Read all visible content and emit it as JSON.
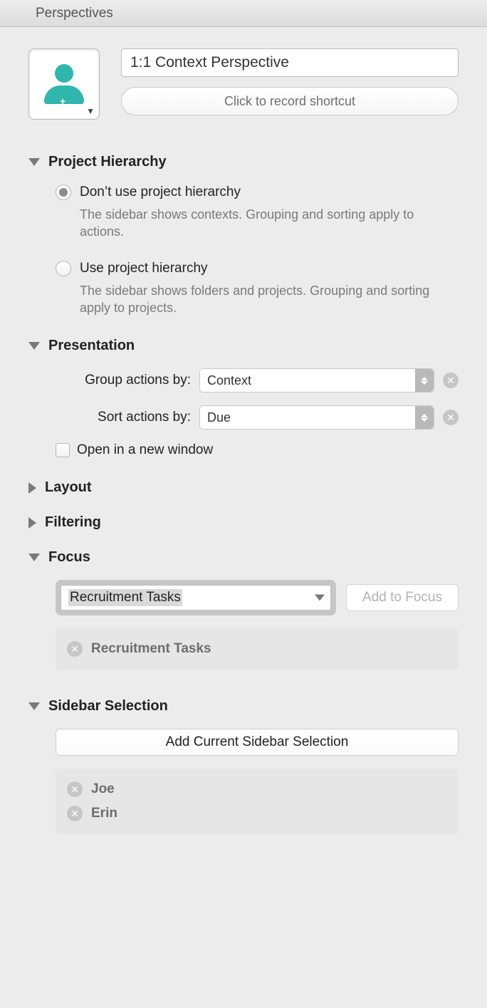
{
  "window_title": "Perspectives",
  "perspective_name": "1:1 Context Perspective",
  "shortcut_placeholder": "Click to record shortcut",
  "sections": {
    "project_hierarchy": {
      "title": "Project Hierarchy",
      "opt1_label": "Don’t use project hierarchy",
      "opt1_desc": "The sidebar shows contexts. Grouping and sorting apply to actions.",
      "opt2_label": "Use project hierarchy",
      "opt2_desc": "The sidebar shows folders and projects. Grouping and sorting apply to projects.",
      "selected": 0
    },
    "presentation": {
      "title": "Presentation",
      "group_label": "Group actions by:",
      "group_value": "Context",
      "sort_label": "Sort actions by:",
      "sort_value": "Due",
      "open_new_window_label": "Open in a new window",
      "open_new_window_checked": false
    },
    "layout": {
      "title": "Layout"
    },
    "filtering": {
      "title": "Filtering"
    },
    "focus": {
      "title": "Focus",
      "combo_value": "Recruitment Tasks",
      "add_btn": "Add to Focus",
      "items": [
        "Recruitment Tasks"
      ]
    },
    "sidebar_selection": {
      "title": "Sidebar Selection",
      "add_btn": "Add Current Sidebar Selection",
      "items": [
        "Joe",
        "Erin"
      ]
    }
  }
}
